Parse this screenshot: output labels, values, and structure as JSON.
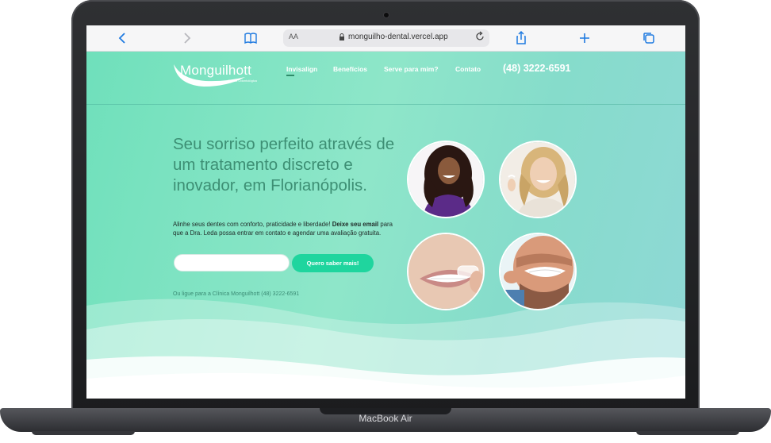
{
  "device": {
    "label": "MacBook Air"
  },
  "browser": {
    "text_size_label": "AA",
    "url": "monguilho-dental.vercel.app",
    "icons": [
      "back-icon",
      "forward-icon",
      "bookmarks-icon",
      "lock-icon",
      "reload-icon",
      "share-icon",
      "new-tab-icon",
      "tabs-icon"
    ]
  },
  "site": {
    "logo": {
      "name": "Monguilhott",
      "subtitle": "Clínica Odontológica"
    },
    "nav": [
      {
        "label": "Invisalign",
        "active": true
      },
      {
        "label": "Benefícios"
      },
      {
        "label": "Serve para mim?"
      },
      {
        "label": "Contato"
      }
    ],
    "phone": "(48) 3222-6591",
    "hero": {
      "headline": "Seu sorriso perfeito através de um tratamento discreto e inovador, em Florianópolis.",
      "lead_prefix": "Alinhe seus dentes com conforto, praticidade e liberdade! ",
      "lead_bold": "Deixe seu email",
      "lead_suffix": " para que a Dra. Leda possa entrar em contato e agendar uma avaliação gratuita.",
      "email_placeholder": "",
      "cta_label": "Quero saber mais!",
      "call_note": "Ou ligue para a Clínica Monguilhott (48) 3222-6591"
    },
    "photos": [
      {
        "name": "woman-purple-sweater-photo"
      },
      {
        "name": "blonde-woman-aligner-photo"
      },
      {
        "name": "smile-clear-aligner-photo"
      },
      {
        "name": "man-inserting-aligner-photo"
      }
    ],
    "colors": {
      "accent": "#1fd59e",
      "heading": "#3d8f74",
      "background_start": "#6fe0bb",
      "background_end": "#8fd8d6"
    }
  }
}
